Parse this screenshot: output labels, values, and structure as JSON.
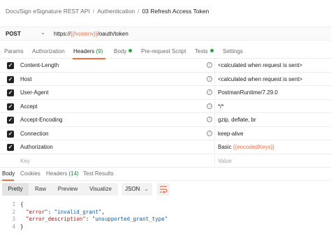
{
  "breadcrumb": {
    "items": [
      "DocuSign eSignature REST API",
      "Authentication",
      "03 Refresh Access Token"
    ],
    "separator": "/"
  },
  "request": {
    "method": "POST",
    "url_prefix": "https://",
    "url_variable": "{{hostenv}}",
    "url_suffix": "/oauth/token"
  },
  "tabs": {
    "params": "Params",
    "authorization": "Authorization",
    "headers": "Headers",
    "headers_count": "(9)",
    "body": "Body",
    "prerequest": "Pre-request Script",
    "tests": "Tests",
    "settings": "Settings"
  },
  "headers": [
    {
      "key": "Content-Length",
      "value": "<calculated when request is sent>",
      "info": true
    },
    {
      "key": "Host",
      "value": "<calculated when request is sent>",
      "info": true
    },
    {
      "key": "User-Agent",
      "value": "PostmanRuntime/7.29.0",
      "info": true
    },
    {
      "key": "Accept",
      "value": "*/*",
      "info": true
    },
    {
      "key": "Accept-Encoding",
      "value": "gzip, deflate, br",
      "info": true
    },
    {
      "key": "Connection",
      "value": "keep-alive",
      "info": true
    },
    {
      "key": "Authorization",
      "value_prefix": "Basic ",
      "value_variable": "{{encodedKeys}}",
      "info": false
    }
  ],
  "new_row": {
    "key_placeholder": "Key",
    "value_placeholder": "Value"
  },
  "response_tabs": {
    "body": "Body",
    "cookies": "Cookies",
    "headers": "Headers",
    "headers_count": "(14)",
    "test_results": "Test Results"
  },
  "view_modes": [
    "Pretty",
    "Raw",
    "Preview",
    "Visualize"
  ],
  "format_select": "JSON",
  "response_body": {
    "lines": [
      {
        "num": "1",
        "text": "{"
      },
      {
        "num": "2",
        "key": "\"error\"",
        "value": "\"invalid_grant\"",
        "trail": ","
      },
      {
        "num": "3",
        "key": "\"error_description\"",
        "value": "\"unsupported_grant_type\"",
        "trail": ""
      },
      {
        "num": "4",
        "text": "}"
      }
    ]
  },
  "colors": {
    "accent": "#f26b3a",
    "variable": "#e8704d",
    "count_green": "#0f8a3f",
    "dot_green": "#28a745"
  },
  "icons": {
    "checkbox": "check-icon",
    "info": "info-icon",
    "wrap": "wrap-lines-icon",
    "dropdown": "chevron-down-icon"
  }
}
